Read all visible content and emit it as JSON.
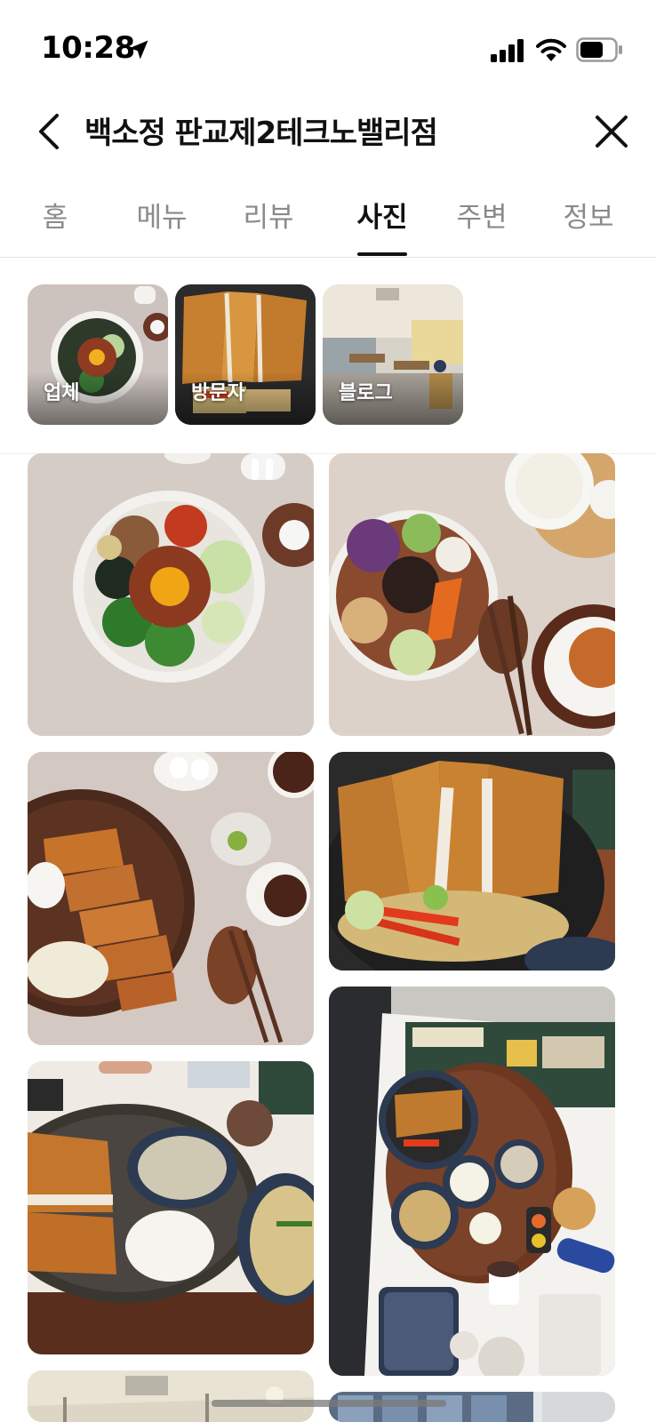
{
  "status_bar": {
    "time": "10:28",
    "icons": [
      "location-arrow-icon",
      "signal-icon",
      "wifi-icon",
      "battery-icon"
    ]
  },
  "header": {
    "title": "백소정 판교제2테크노밸리점",
    "back_icon": "chevron-left-icon",
    "close_icon": "close-icon"
  },
  "tabs": [
    {
      "label": "홈",
      "active": false
    },
    {
      "label": "메뉴",
      "active": false
    },
    {
      "label": "리뷰",
      "active": false
    },
    {
      "label": "사진",
      "active": true
    },
    {
      "label": "주변",
      "active": false
    },
    {
      "label": "정보",
      "active": false
    }
  ],
  "categories": [
    {
      "label": "업체"
    },
    {
      "label": "방문자"
    },
    {
      "label": "블로그"
    }
  ],
  "photos": [
    {
      "alt": "bibimbap-bowl-photo"
    },
    {
      "alt": "cold-noodle-bowl-photo"
    },
    {
      "alt": "pork-cutlet-plate-photo"
    },
    {
      "alt": "katsu-rice-bowl-photo"
    },
    {
      "alt": "tray-meal-overhead-photo"
    },
    {
      "alt": "katsu-set-with-udon-photo"
    },
    {
      "alt": "restaurant-interior-photo"
    },
    {
      "alt": "storefront-photo"
    }
  ],
  "colors": {
    "active_tab": "#111111",
    "inactive_tab": "#8a8a8a",
    "divider": "#e2e2e2"
  }
}
